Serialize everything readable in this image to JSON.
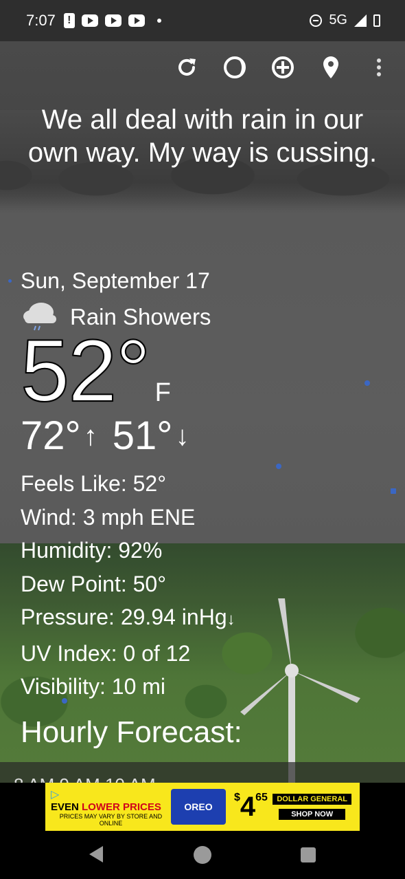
{
  "status_bar": {
    "time": "7:07",
    "network": "5G"
  },
  "toolbar": {
    "icons": [
      "refresh-icon",
      "moon-phase-icon",
      "add-icon",
      "location-icon",
      "overflow-menu-icon"
    ]
  },
  "quote": "We all deal with rain in our own way. My way is cussing.",
  "current": {
    "date": "Sun, September 17",
    "condition": "Rain Showers",
    "temperature": "52°",
    "unit": "F",
    "high": "72°",
    "low": "51°"
  },
  "details": {
    "feels_like": "Feels Like:  52°",
    "wind": "Wind:  3 mph ENE",
    "humidity": "Humidity:  92%",
    "dew_point": "Dew Point:  50°",
    "pressure": "Pressure:  29.94 inHg",
    "uv_index": "UV Index:  0 of 12",
    "visibility": "Visibility:  10 mi"
  },
  "hourly": {
    "title": "Hourly Forecast:",
    "strip": "8 AM        9 AM        10 AM"
  },
  "ad": {
    "headline_part1": "EVEN ",
    "headline_part2": "LOWER PRICES",
    "fine_print": "PRICES MAY VARY BY STORE AND ONLINE",
    "product": "OREO",
    "price_dollar": "$",
    "price_main": "4",
    "price_cents": "65",
    "brand": "DOLLAR GENERAL",
    "cta": "SHOP NOW",
    "brand_color": "#f8e71c"
  }
}
